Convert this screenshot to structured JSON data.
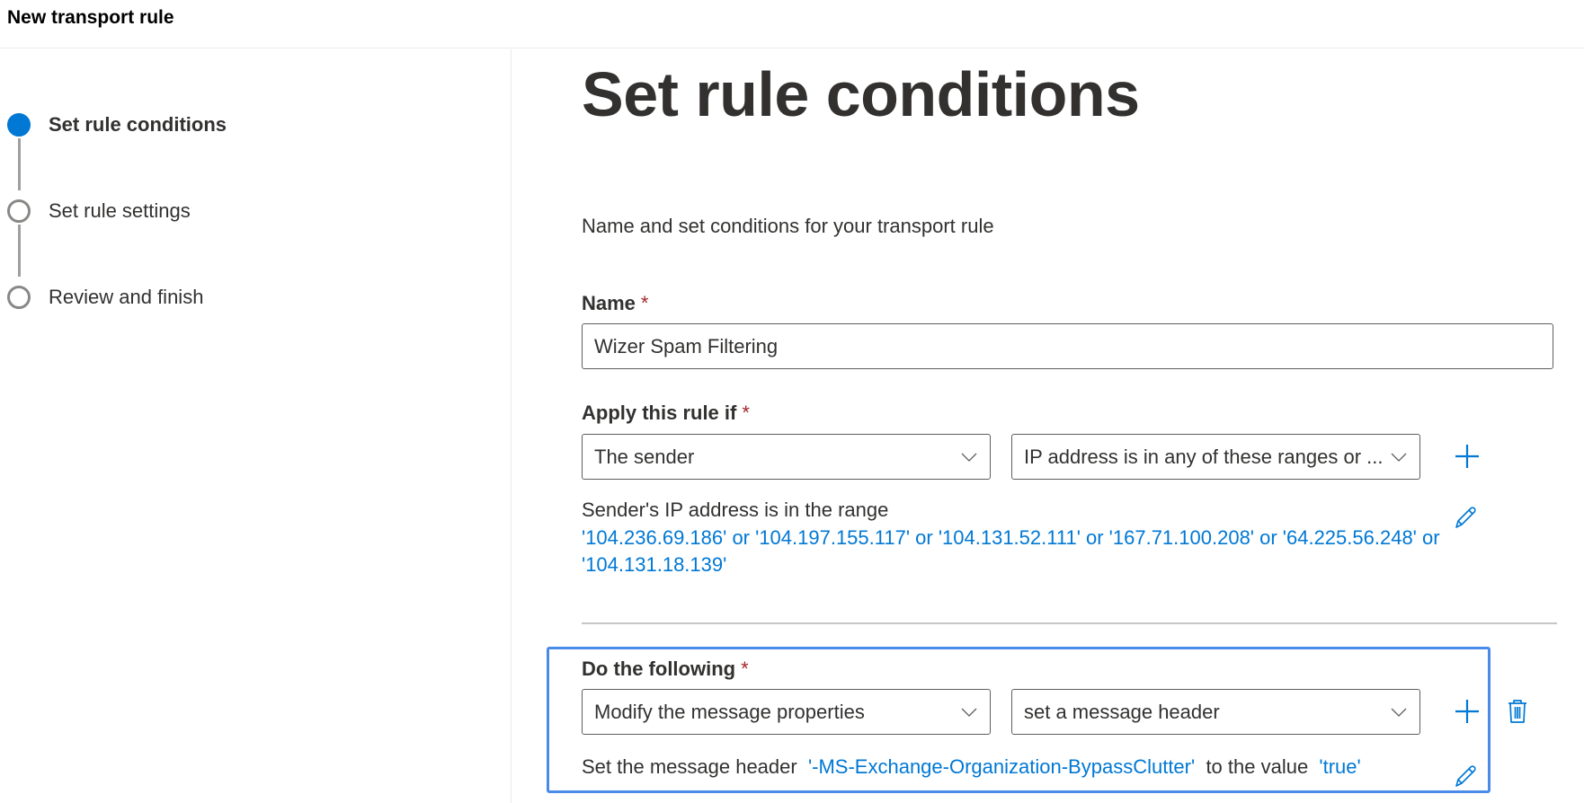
{
  "header": {
    "title": "New transport rule"
  },
  "wizard_steps": [
    {
      "label": "Set rule conditions",
      "state": "active"
    },
    {
      "label": "Set rule settings",
      "state": "pending"
    },
    {
      "label": "Review and finish",
      "state": "pending"
    }
  ],
  "main": {
    "title": "Set rule conditions",
    "subtitle": "Name and set conditions for your transport rule",
    "required_marker": "*",
    "name_field": {
      "label": "Name",
      "value": "Wizer Spam Filtering"
    },
    "condition": {
      "label": "Apply this rule if",
      "subject_dropdown": "The sender",
      "predicate_dropdown": "IP address is in any of these ranges or ...",
      "summary_prefix": "Sender's IP address is in the range",
      "ip_line_1": "'104.236.69.186' or '104.197.155.117' or '104.131.52.111' or '167.71.100.208' or '64.225.56.248' or",
      "ip_line_2": "'104.131.18.139'",
      "ip_addresses": [
        "104.236.69.186",
        "104.197.155.117",
        "104.131.52.111",
        "167.71.100.208",
        "64.225.56.248",
        "104.131.18.139"
      ]
    },
    "action": {
      "label": "Do the following",
      "action_dropdown": "Modify the message properties",
      "property_dropdown": "set a message header",
      "summary_prefix": "Set the message header",
      "header_name": "'-MS-Exchange-Organization-BypassClutter'",
      "summary_middle": "to the value",
      "header_value": "'true'"
    }
  },
  "icons": {
    "add": "plus-icon",
    "edit": "pencil-icon",
    "delete": "trash-icon",
    "expand": "chevron-down-icon"
  },
  "colors": {
    "accent": "#0078d4",
    "required": "#a4262c",
    "focus_border": "#4a8ae8",
    "text": "#323130"
  }
}
